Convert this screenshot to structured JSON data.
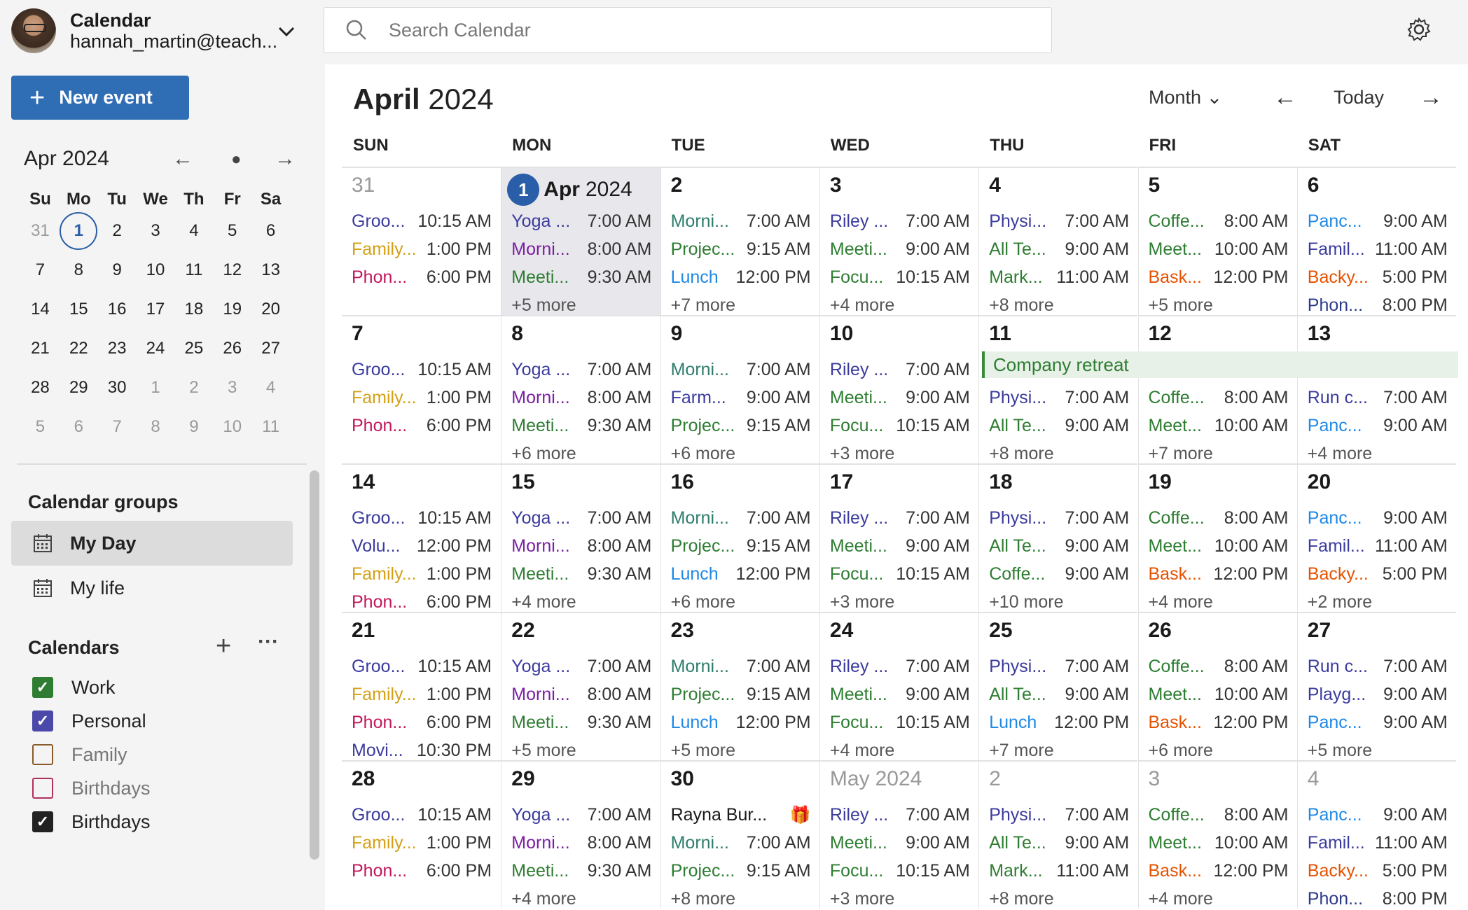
{
  "account": {
    "app": "Calendar",
    "email": "hannah_martin@teach..."
  },
  "new_event": "New event",
  "search": {
    "placeholder": "Search Calendar"
  },
  "mini": {
    "title": "Apr 2024",
    "days": [
      "Su",
      "Mo",
      "Tu",
      "We",
      "Th",
      "Fr",
      "Sa"
    ],
    "weeks": [
      [
        "31",
        "1",
        "2",
        "3",
        "4",
        "5",
        "6"
      ],
      [
        "7",
        "8",
        "9",
        "10",
        "11",
        "12",
        "13"
      ],
      [
        "14",
        "15",
        "16",
        "17",
        "18",
        "19",
        "20"
      ],
      [
        "21",
        "22",
        "23",
        "24",
        "25",
        "26",
        "27"
      ],
      [
        "28",
        "29",
        "30",
        "1",
        "2",
        "3",
        "4"
      ],
      [
        "5",
        "6",
        "7",
        "8",
        "9",
        "10",
        "11"
      ]
    ],
    "dim": [
      [
        0,
        0
      ],
      [
        4,
        3
      ],
      [
        4,
        4
      ],
      [
        4,
        5
      ],
      [
        4,
        6
      ],
      [
        5,
        0
      ],
      [
        5,
        1
      ],
      [
        5,
        2
      ],
      [
        5,
        3
      ],
      [
        5,
        4
      ],
      [
        5,
        5
      ],
      [
        5,
        6
      ]
    ],
    "today": [
      0,
      1
    ]
  },
  "groups": {
    "title": "Calendar groups",
    "items": [
      "My Day",
      "My life"
    ]
  },
  "calendars": {
    "title": "Calendars",
    "items": [
      {
        "label": "Work",
        "checked": true,
        "color": "#2e7d32"
      },
      {
        "label": "Personal",
        "checked": true,
        "color": "#4a48a8"
      },
      {
        "label": "Family",
        "checked": false,
        "color": "#8a5a2a"
      },
      {
        "label": "Birthdays",
        "checked": false,
        "color": "#b03060"
      },
      {
        "label": "Birthdays",
        "checked": true,
        "color": "#222222"
      }
    ]
  },
  "header": {
    "month": "April",
    "year": "2024",
    "view": "Month",
    "today": "Today"
  },
  "weekdays": [
    "SUN",
    "MON",
    "TUE",
    "WED",
    "THU",
    "FRI",
    "SAT"
  ],
  "colors": {
    "indigo": "#3b3b9e",
    "gold": "#d4a017",
    "pink": "#c2185b",
    "teal": "#2e7d6b",
    "green": "#2e7d32",
    "purple": "#7b1fa2",
    "blue": "#1e88e5",
    "brown": "#b5651d",
    "orange": "#e65100",
    "navy": "#2a3a8a"
  },
  "retreat": "Company retreat",
  "weeks": [
    [
      {
        "day": "31",
        "dim": true,
        "ev": [
          [
            "Groo...",
            "10:15 AM",
            "indigo"
          ],
          [
            "Family...",
            "1:00 PM",
            "gold"
          ],
          [
            "Phon...",
            "6:00 PM",
            "pink"
          ]
        ],
        "more": ""
      },
      {
        "day": "1",
        "today": true,
        "month": "Apr",
        "year": "2024",
        "ev": [
          [
            "Yoga ...",
            "7:00 AM",
            "indigo"
          ],
          [
            "Morni...",
            "8:00 AM",
            "purple"
          ],
          [
            "Meeti...",
            "9:30 AM",
            "green"
          ]
        ],
        "more": "+5 more"
      },
      {
        "day": "2",
        "ev": [
          [
            "Morni...",
            "7:00 AM",
            "teal"
          ],
          [
            "Projec...",
            "9:15 AM",
            "green"
          ],
          [
            "Lunch",
            "12:00 PM",
            "blue"
          ]
        ],
        "more": "+7 more"
      },
      {
        "day": "3",
        "ev": [
          [
            "Riley ...",
            "7:00 AM",
            "indigo"
          ],
          [
            "Meeti...",
            "9:00 AM",
            "green"
          ],
          [
            "Focu...",
            "10:15 AM",
            "green"
          ]
        ],
        "more": "+4 more"
      },
      {
        "day": "4",
        "ev": [
          [
            "Physi...",
            "7:00 AM",
            "indigo"
          ],
          [
            "All Te...",
            "9:00 AM",
            "green"
          ],
          [
            "Mark...",
            "11:00 AM",
            "green"
          ]
        ],
        "more": "+8 more"
      },
      {
        "day": "5",
        "ev": [
          [
            "Coffe...",
            "8:00 AM",
            "green"
          ],
          [
            "Meet...",
            "10:00 AM",
            "green"
          ],
          [
            "Bask...",
            "12:00 PM",
            "orange"
          ]
        ],
        "more": "+5 more"
      },
      {
        "day": "6",
        "ev": [
          [
            "Panc...",
            "9:00 AM",
            "blue"
          ],
          [
            "Famil...",
            "11:00 AM",
            "indigo"
          ],
          [
            "Backy...",
            "5:00 PM",
            "orange"
          ],
          [
            "Phon...",
            "8:00 PM",
            "navy"
          ]
        ],
        "more": ""
      }
    ],
    [
      {
        "day": "7",
        "ev": [
          [
            "Groo...",
            "10:15 AM",
            "indigo"
          ],
          [
            "Family...",
            "1:00 PM",
            "gold"
          ],
          [
            "Phon...",
            "6:00 PM",
            "pink"
          ]
        ],
        "more": ""
      },
      {
        "day": "8",
        "ev": [
          [
            "Yoga ...",
            "7:00 AM",
            "indigo"
          ],
          [
            "Morni...",
            "8:00 AM",
            "purple"
          ],
          [
            "Meeti...",
            "9:30 AM",
            "green"
          ]
        ],
        "more": "+6 more"
      },
      {
        "day": "9",
        "ev": [
          [
            "Morni...",
            "7:00 AM",
            "teal"
          ],
          [
            "Farm...",
            "9:00 AM",
            "indigo"
          ],
          [
            "Projec...",
            "9:15 AM",
            "green"
          ]
        ],
        "more": "+6 more"
      },
      {
        "day": "10",
        "ev": [
          [
            "Riley ...",
            "7:00 AM",
            "indigo"
          ],
          [
            "Meeti...",
            "9:00 AM",
            "green"
          ],
          [
            "Focu...",
            "10:15 AM",
            "green"
          ]
        ],
        "more": "+3 more"
      },
      {
        "day": "11",
        "retreat": true,
        "ev": [
          [
            "Physi...",
            "7:00 AM",
            "indigo"
          ],
          [
            "All Te...",
            "9:00 AM",
            "green"
          ]
        ],
        "more": "+8 more"
      },
      {
        "day": "12",
        "retreat": true,
        "ev": [
          [
            "Coffe...",
            "8:00 AM",
            "green"
          ],
          [
            "Meet...",
            "10:00 AM",
            "green"
          ]
        ],
        "more": "+7 more"
      },
      {
        "day": "13",
        "retreat": true,
        "ev": [
          [
            "Run c...",
            "7:00 AM",
            "indigo"
          ],
          [
            "Panc...",
            "9:00 AM",
            "blue"
          ]
        ],
        "more": "+4 more"
      }
    ],
    [
      {
        "day": "14",
        "ev": [
          [
            "Groo...",
            "10:15 AM",
            "indigo"
          ],
          [
            "Volu...",
            "12:00 PM",
            "indigo"
          ],
          [
            "Family...",
            "1:00 PM",
            "gold"
          ],
          [
            "Phon...",
            "6:00 PM",
            "pink"
          ]
        ],
        "more": ""
      },
      {
        "day": "15",
        "ev": [
          [
            "Yoga ...",
            "7:00 AM",
            "indigo"
          ],
          [
            "Morni...",
            "8:00 AM",
            "purple"
          ],
          [
            "Meeti...",
            "9:30 AM",
            "green"
          ]
        ],
        "more": "+4 more"
      },
      {
        "day": "16",
        "ev": [
          [
            "Morni...",
            "7:00 AM",
            "teal"
          ],
          [
            "Projec...",
            "9:15 AM",
            "green"
          ],
          [
            "Lunch",
            "12:00 PM",
            "blue"
          ]
        ],
        "more": "+6 more"
      },
      {
        "day": "17",
        "ev": [
          [
            "Riley ...",
            "7:00 AM",
            "indigo"
          ],
          [
            "Meeti...",
            "9:00 AM",
            "green"
          ],
          [
            "Focu...",
            "10:15 AM",
            "green"
          ]
        ],
        "more": "+3 more"
      },
      {
        "day": "18",
        "ev": [
          [
            "Physi...",
            "7:00 AM",
            "indigo"
          ],
          [
            "All Te...",
            "9:00 AM",
            "green"
          ],
          [
            "Coffe...",
            "9:00 AM",
            "green"
          ]
        ],
        "more": "+10 more"
      },
      {
        "day": "19",
        "ev": [
          [
            "Coffe...",
            "8:00 AM",
            "green"
          ],
          [
            "Meet...",
            "10:00 AM",
            "green"
          ],
          [
            "Bask...",
            "12:00 PM",
            "orange"
          ]
        ],
        "more": "+4 more"
      },
      {
        "day": "20",
        "ev": [
          [
            "Panc...",
            "9:00 AM",
            "blue"
          ],
          [
            "Famil...",
            "11:00 AM",
            "indigo"
          ],
          [
            "Backy...",
            "5:00 PM",
            "orange"
          ]
        ],
        "more": "+2 more"
      }
    ],
    [
      {
        "day": "21",
        "ev": [
          [
            "Groo...",
            "10:15 AM",
            "indigo"
          ],
          [
            "Family...",
            "1:00 PM",
            "gold"
          ],
          [
            "Phon...",
            "6:00 PM",
            "pink"
          ],
          [
            "Movi...",
            "10:30 PM",
            "indigo"
          ]
        ],
        "more": ""
      },
      {
        "day": "22",
        "ev": [
          [
            "Yoga ...",
            "7:00 AM",
            "indigo"
          ],
          [
            "Morni...",
            "8:00 AM",
            "purple"
          ],
          [
            "Meeti...",
            "9:30 AM",
            "green"
          ]
        ],
        "more": "+5 more"
      },
      {
        "day": "23",
        "ev": [
          [
            "Morni...",
            "7:00 AM",
            "teal"
          ],
          [
            "Projec...",
            "9:15 AM",
            "green"
          ],
          [
            "Lunch",
            "12:00 PM",
            "blue"
          ]
        ],
        "more": "+5 more"
      },
      {
        "day": "24",
        "ev": [
          [
            "Riley ...",
            "7:00 AM",
            "indigo"
          ],
          [
            "Meeti...",
            "9:00 AM",
            "green"
          ],
          [
            "Focu...",
            "10:15 AM",
            "green"
          ]
        ],
        "more": "+4 more"
      },
      {
        "day": "25",
        "ev": [
          [
            "Physi...",
            "7:00 AM",
            "indigo"
          ],
          [
            "All Te...",
            "9:00 AM",
            "green"
          ],
          [
            "Lunch",
            "12:00 PM",
            "blue"
          ]
        ],
        "more": "+7 more"
      },
      {
        "day": "26",
        "ev": [
          [
            "Coffe...",
            "8:00 AM",
            "green"
          ],
          [
            "Meet...",
            "10:00 AM",
            "green"
          ],
          [
            "Bask...",
            "12:00 PM",
            "orange"
          ]
        ],
        "more": "+6 more"
      },
      {
        "day": "27",
        "ev": [
          [
            "Run c...",
            "7:00 AM",
            "indigo"
          ],
          [
            "Playg...",
            "9:00 AM",
            "indigo"
          ],
          [
            "Panc...",
            "9:00 AM",
            "blue"
          ]
        ],
        "more": "+5 more"
      }
    ],
    [
      {
        "day": "28",
        "ev": [
          [
            "Groo...",
            "10:15 AM",
            "indigo"
          ],
          [
            "Family...",
            "1:00 PM",
            "gold"
          ],
          [
            "Phon...",
            "6:00 PM",
            "pink"
          ]
        ],
        "more": ""
      },
      {
        "day": "29",
        "ev": [
          [
            "Yoga ...",
            "7:00 AM",
            "indigo"
          ],
          [
            "Morni...",
            "8:00 AM",
            "purple"
          ],
          [
            "Meeti...",
            "9:30 AM",
            "green"
          ]
        ],
        "more": "+4 more"
      },
      {
        "day": "30",
        "gift": true,
        "ev": [
          [
            "Rayna Bur...",
            "",
            "dark"
          ],
          [
            "Morni...",
            "7:00 AM",
            "teal"
          ],
          [
            "Projec...",
            "9:15 AM",
            "green"
          ]
        ],
        "more": "+8 more"
      },
      {
        "day": "May",
        "dim": true,
        "year": "2024",
        "ev": [
          [
            "Riley ...",
            "7:00 AM",
            "indigo"
          ],
          [
            "Meeti...",
            "9:00 AM",
            "green"
          ],
          [
            "Focu...",
            "10:15 AM",
            "green"
          ]
        ],
        "more": "+3 more"
      },
      {
        "day": "2",
        "dim": true,
        "ev": [
          [
            "Physi...",
            "7:00 AM",
            "indigo"
          ],
          [
            "All Te...",
            "9:00 AM",
            "green"
          ],
          [
            "Mark...",
            "11:00 AM",
            "green"
          ]
        ],
        "more": "+8 more"
      },
      {
        "day": "3",
        "dim": true,
        "ev": [
          [
            "Coffe...",
            "8:00 AM",
            "green"
          ],
          [
            "Meet...",
            "10:00 AM",
            "green"
          ],
          [
            "Bask...",
            "12:00 PM",
            "orange"
          ]
        ],
        "more": "+4 more"
      },
      {
        "day": "4",
        "dim": true,
        "ev": [
          [
            "Panc...",
            "9:00 AM",
            "blue"
          ],
          [
            "Famil...",
            "11:00 AM",
            "indigo"
          ],
          [
            "Backy...",
            "5:00 PM",
            "orange"
          ],
          [
            "Phon...",
            "8:00 PM",
            "navy"
          ]
        ],
        "more": ""
      }
    ]
  ]
}
